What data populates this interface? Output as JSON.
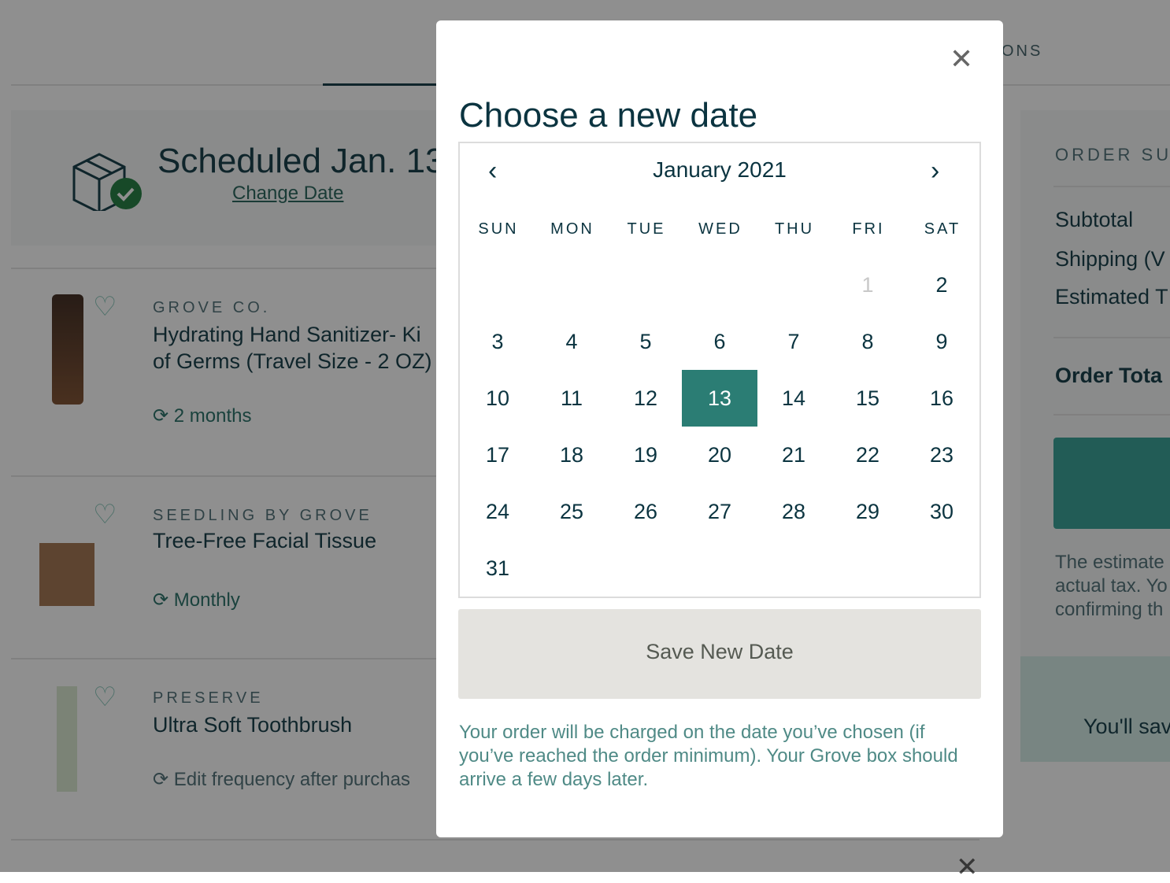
{
  "background": {
    "tab_fragment": "ONS",
    "scheduled_title": "Scheduled Jan. 13",
    "change_date": "Change Date",
    "items": [
      {
        "brand": "GROVE CO.",
        "name": "Hydrating Hand Sanitizer- Ki\nof Germs (Travel Size - 2 OZ)",
        "frequency": "2 months"
      },
      {
        "brand": "SEEDLING BY GROVE",
        "name": "Tree-Free Facial Tissue",
        "frequency": "Monthly"
      },
      {
        "brand": "PRESERVE",
        "name": "Ultra Soft Toothbrush",
        "frequency": "Edit frequency after purchas"
      }
    ],
    "summary": {
      "title": "ORDER SU",
      "subtotal": "Subtotal",
      "shipping": "Shipping (V",
      "tax": "Estimated T",
      "total": "Order Tota",
      "note": "The estimate\nactual tax. Yo\nconfirming th",
      "savings": "You'll sav"
    }
  },
  "modal": {
    "title": "Choose a new date",
    "month_label": "January 2021",
    "weekdays": [
      "SUN",
      "MON",
      "TUE",
      "WED",
      "THU",
      "FRI",
      "SAT"
    ],
    "first_weekday_index": 5,
    "days_in_month": 31,
    "selected_day": 13,
    "disabled_days": [
      1
    ],
    "save_label": "Save New Date",
    "note": "Your order will be charged on the date you’ve chosen (if you’ve reached the order minimum). Your Grove box should arrive a few days later.",
    "colors": {
      "selected": "#2b7d74",
      "text": "#0b3440",
      "note": "#4f8a86"
    }
  }
}
